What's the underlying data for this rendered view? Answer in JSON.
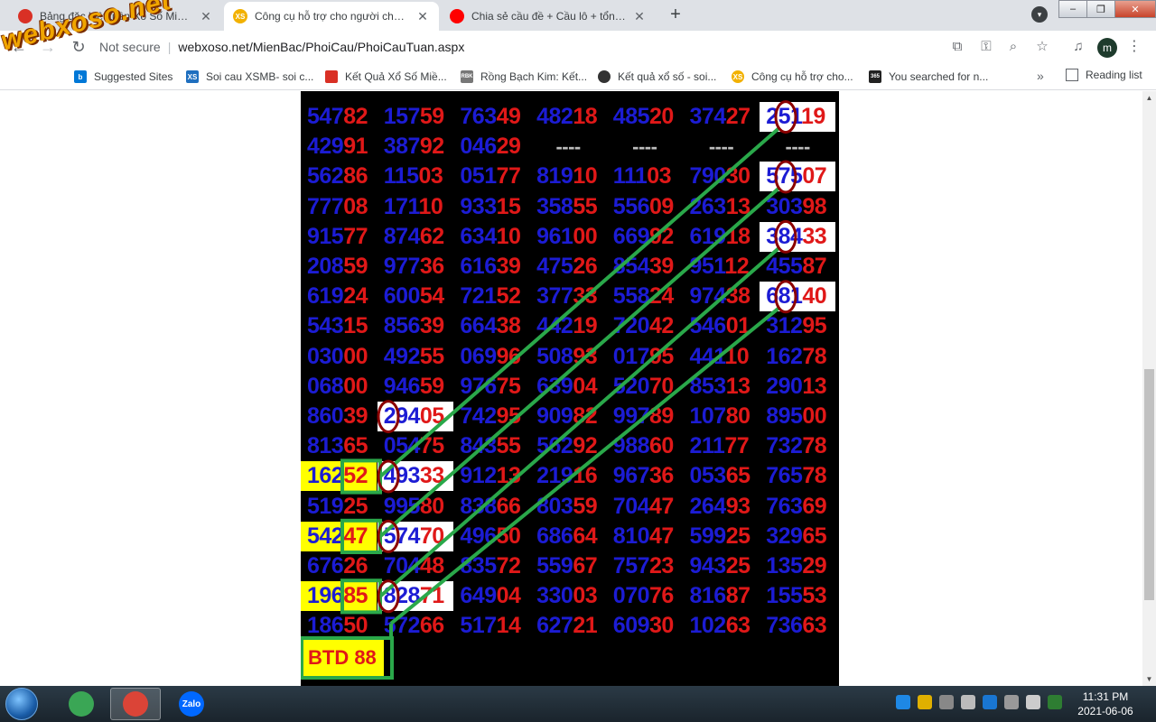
{
  "browser": {
    "tabs": [
      {
        "label": "Bảng đặc biệt tuần Xổ Số Miền Bắc",
        "active": false,
        "fav_color": "#d93025"
      },
      {
        "label": "Công cụ hỗ trợ cho người chơi xổ số",
        "active": true,
        "fav_color": "#f2b100",
        "fav_text": "XS"
      },
      {
        "label": "Chia sẻ cầu đề + Cầu lô + tổng đề",
        "active": false,
        "fav_color": "#ff0000"
      }
    ],
    "close_glyph": "✕",
    "new_tab_glyph": "+",
    "address": {
      "security": "Not secure",
      "url": "webxoso.net/MienBac/PhoiCau/PhoiCauTuan.aspx"
    },
    "profile_initial": "m",
    "bookmarks": [
      {
        "label": "Suggested Sites",
        "color": "#0078d7",
        "icon_text": "b"
      },
      {
        "label": "Soi cau XSMB- soi c...",
        "color": "#1f6fbf",
        "icon_text": "XS"
      },
      {
        "label": "Kết Quả Xổ Số Miề...",
        "color": "#d93025",
        "icon_text": ""
      },
      {
        "label": "Rồng Bạch Kim: Kết...",
        "color": "#777777",
        "icon_text": "RBK"
      },
      {
        "label": "Kết quả xổ số - soi...",
        "color": "#333333",
        "icon_text": ""
      },
      {
        "label": "Công cụ hỗ trợ cho...",
        "color": "#f2b100",
        "icon_text": "XS"
      },
      {
        "label": "You searched for n...",
        "color": "#222222",
        "icon_text": "365"
      }
    ],
    "bookmarks_more": "»",
    "reading_list": "Reading list"
  },
  "watermark": "webxoso.net",
  "board": {
    "rows": [
      {
        "cells": [
          [
            "547",
            "82"
          ],
          [
            "157",
            "59"
          ],
          [
            "763",
            "49"
          ],
          [
            "482",
            "18"
          ],
          [
            "485",
            "20"
          ],
          [
            "374",
            "27"
          ],
          [
            "251",
            "19"
          ]
        ],
        "white": [
          6
        ]
      },
      {
        "cells": [
          [
            "429",
            "91"
          ],
          [
            "387",
            "92"
          ],
          [
            "046",
            "29"
          ],
          "----",
          "----",
          "----",
          "----"
        ],
        "white": []
      },
      {
        "cells": [
          [
            "562",
            "86"
          ],
          [
            "115",
            "03"
          ],
          [
            "051",
            "77"
          ],
          [
            "819",
            "10"
          ],
          [
            "111",
            "03"
          ],
          [
            "790",
            "30"
          ],
          [
            "575",
            "07"
          ]
        ],
        "white": [
          6
        ]
      },
      {
        "cells": [
          [
            "777",
            "08"
          ],
          [
            "171",
            "10"
          ],
          [
            "933",
            "15"
          ],
          [
            "358",
            "55"
          ],
          [
            "556",
            "09"
          ],
          [
            "263",
            "13"
          ],
          [
            "303",
            "98"
          ]
        ],
        "white": []
      },
      {
        "cells": [
          [
            "915",
            "77"
          ],
          [
            "874",
            "62"
          ],
          [
            "634",
            "10"
          ],
          [
            "961",
            "00"
          ],
          [
            "669",
            "92"
          ],
          [
            "619",
            "18"
          ],
          [
            "384",
            "33"
          ]
        ],
        "white": [
          6
        ]
      },
      {
        "cells": [
          [
            "208",
            "59"
          ],
          [
            "977",
            "36"
          ],
          [
            "616",
            "39"
          ],
          [
            "475",
            "26"
          ],
          [
            "854",
            "39"
          ],
          [
            "951",
            "12"
          ],
          [
            "455",
            "87"
          ]
        ],
        "white": []
      },
      {
        "cells": [
          [
            "619",
            "24"
          ],
          [
            "600",
            "54"
          ],
          [
            "721",
            "52"
          ],
          [
            "377",
            "33"
          ],
          [
            "558",
            "24"
          ],
          [
            "974",
            "38"
          ],
          [
            "681",
            "40"
          ]
        ],
        "white": [
          6
        ]
      },
      {
        "cells": [
          [
            "543",
            "15"
          ],
          [
            "856",
            "39"
          ],
          [
            "664",
            "38"
          ],
          [
            "442",
            "19"
          ],
          [
            "720",
            "42"
          ],
          [
            "546",
            "01"
          ],
          [
            "312",
            "95"
          ]
        ],
        "white": []
      },
      {
        "cells": [
          [
            "030",
            "00"
          ],
          [
            "492",
            "55"
          ],
          [
            "069",
            "96"
          ],
          [
            "508",
            "93"
          ],
          [
            "017",
            "95"
          ],
          [
            "441",
            "10"
          ],
          [
            "162",
            "78"
          ]
        ],
        "white": []
      },
      {
        "cells": [
          [
            "068",
            "00"
          ],
          [
            "946",
            "59"
          ],
          [
            "976",
            "75"
          ],
          [
            "639",
            "04"
          ],
          [
            "520",
            "70"
          ],
          [
            "853",
            "13"
          ],
          [
            "290",
            "13"
          ]
        ],
        "white": []
      },
      {
        "cells": [
          [
            "860",
            "39"
          ],
          [
            "294",
            "05"
          ],
          [
            "742",
            "95"
          ],
          [
            "909",
            "82"
          ],
          [
            "997",
            "89"
          ],
          [
            "107",
            "80"
          ],
          [
            "895",
            "00"
          ]
        ],
        "white": [
          1
        ]
      },
      {
        "cells": [
          [
            "813",
            "65"
          ],
          [
            "054",
            "75"
          ],
          [
            "843",
            "55"
          ],
          [
            "562",
            "92"
          ],
          [
            "988",
            "60"
          ],
          [
            "211",
            "77"
          ],
          [
            "732",
            "78"
          ]
        ],
        "white": []
      },
      {
        "cells": [
          [
            "162",
            "52"
          ],
          [
            "493",
            "33"
          ],
          [
            "912",
            "13"
          ],
          [
            "219",
            "16"
          ],
          [
            "967",
            "36"
          ],
          [
            "053",
            "65"
          ],
          [
            "765",
            "78"
          ]
        ],
        "white": [
          1
        ],
        "yellow": [
          0
        ]
      },
      {
        "cells": [
          [
            "519",
            "25"
          ],
          [
            "995",
            "80"
          ],
          [
            "838",
            "66"
          ],
          [
            "803",
            "59"
          ],
          [
            "704",
            "47"
          ],
          [
            "264",
            "93"
          ],
          [
            "763",
            "69"
          ]
        ],
        "white": []
      },
      {
        "cells": [
          [
            "542",
            "47"
          ],
          [
            "574",
            "70"
          ],
          [
            "496",
            "50"
          ],
          [
            "686",
            "64"
          ],
          [
            "810",
            "47"
          ],
          [
            "599",
            "25"
          ],
          [
            "329",
            "65"
          ]
        ],
        "white": [
          1
        ],
        "yellow": [
          0
        ]
      },
      {
        "cells": [
          [
            "676",
            "26"
          ],
          [
            "704",
            "48"
          ],
          [
            "835",
            "72"
          ],
          [
            "559",
            "67"
          ],
          [
            "757",
            "23"
          ],
          [
            "943",
            "25"
          ],
          [
            "135",
            "29"
          ]
        ],
        "white": []
      },
      {
        "cells": [
          [
            "196",
            "85"
          ],
          [
            "828",
            "71"
          ],
          [
            "649",
            "04"
          ],
          [
            "330",
            "03"
          ],
          [
            "070",
            "76"
          ],
          [
            "816",
            "87"
          ],
          [
            "155",
            "53"
          ]
        ],
        "white": [
          1
        ],
        "yellow": [
          0
        ]
      },
      {
        "cells": [
          [
            "186",
            "50"
          ],
          [
            "572",
            "66"
          ],
          [
            "517",
            "14"
          ],
          [
            "627",
            "21"
          ],
          [
            "609",
            "30"
          ],
          [
            "102",
            "63"
          ],
          [
            "736",
            "63"
          ]
        ],
        "white": []
      }
    ],
    "btd": "BTD 88"
  },
  "taskbar": {
    "apps": [
      {
        "name": "Cốc Cốc",
        "color": "#3aa655",
        "active": false
      },
      {
        "name": "Chrome",
        "color": "#db4437",
        "active": true
      },
      {
        "name": "Zalo",
        "color": "#0068ff",
        "active": false
      }
    ],
    "tray_icons": [
      "#1e88e5",
      "#e0b000",
      "#888888",
      "#bbbbbb",
      "#1976d2",
      "#999999",
      "#cccccc",
      "#2e7d32"
    ],
    "time": "11:31 PM",
    "date": "2021-06-06"
  }
}
